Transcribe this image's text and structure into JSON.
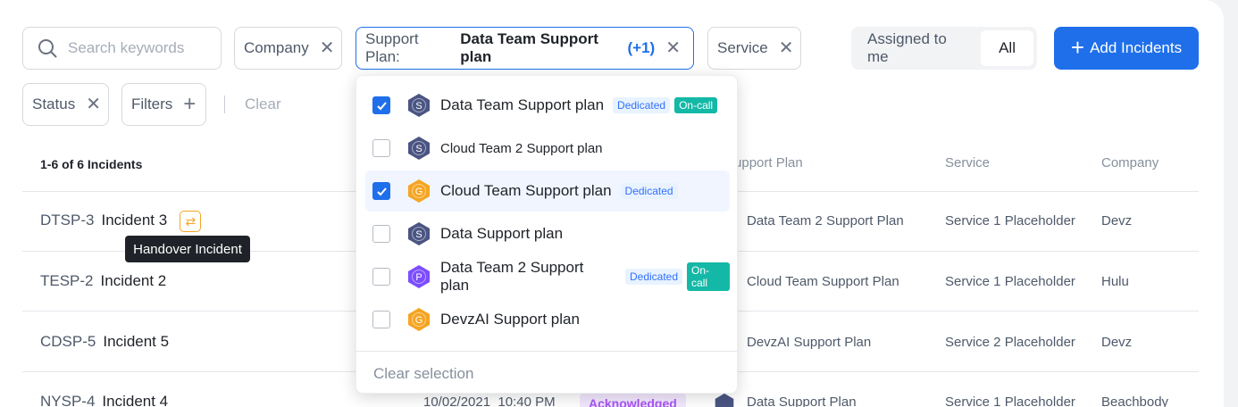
{
  "search": {
    "placeholder": "Search keywords"
  },
  "filters": {
    "company": "Company",
    "support_plan_label": "Support Plan:",
    "support_plan_value": "Data Team Support plan",
    "support_plan_extra": "(+1)",
    "service": "Service",
    "status": "Status",
    "filters_label": "Filters",
    "clear": "Clear"
  },
  "toggle": {
    "assigned": "Assigned to me",
    "all": "All"
  },
  "add_button": "Add Incidents",
  "table": {
    "count": "1-6 of 6 Incidents",
    "headers": {
      "support_plan": "Support Plan",
      "service": "Service",
      "company": "Company"
    },
    "rows": [
      {
        "id": "DTSP-3",
        "title": "Incident 3",
        "plan": "Data Team 2 Support Plan",
        "service": "Service 1 Placeholder",
        "company": "Devz"
      },
      {
        "id": "TESP-2",
        "title": "Incident 2",
        "plan": "Cloud Team Support Plan",
        "service": "Service 1 Placeholder",
        "company": "Hulu"
      },
      {
        "id": "CDSP-5",
        "title": "Incident 5",
        "plan": "DevzAI Support Plan",
        "service": "Service 2 Placeholder",
        "company": "Devz"
      },
      {
        "id": "NYSP-4",
        "title": "Incident 4",
        "date": "10/02/2021",
        "time": "10:40 PM",
        "status": "Acknowledged",
        "plan": "Data Support Plan",
        "service": "Service 1 Placeholder",
        "company": "Beachbody"
      }
    ]
  },
  "tooltip": "Handover Incident",
  "dropdown": {
    "options": [
      {
        "label": "Data Team Support plan",
        "checked": true,
        "icon": "S",
        "icon_color": "#4b5583",
        "tags": [
          "Dedicated",
          "On-call"
        ]
      },
      {
        "label": "Cloud Team 2 Support plan",
        "checked": false,
        "icon": "S",
        "icon_color": "#4b5583",
        "tags": []
      },
      {
        "label": "Cloud Team Support plan",
        "checked": true,
        "icon": "G",
        "icon_color": "#f5a524",
        "tags": [
          "Dedicated"
        ]
      },
      {
        "label": "Data Support plan",
        "checked": false,
        "icon": "S",
        "icon_color": "#4b5583",
        "tags": []
      },
      {
        "label": "Data Team 2 Support plan",
        "checked": false,
        "icon": "P",
        "icon_color": "#7c4dff",
        "tags": [
          "Dedicated",
          "On-call"
        ]
      },
      {
        "label": "DevzAI Support plan",
        "checked": false,
        "icon": "G",
        "icon_color": "#f5a524",
        "tags": []
      }
    ],
    "clear_selection": "Clear selection"
  },
  "colors": {
    "accent": "#1f6feb",
    "oncall": "#14b8a6",
    "warning": "#f5a524"
  }
}
